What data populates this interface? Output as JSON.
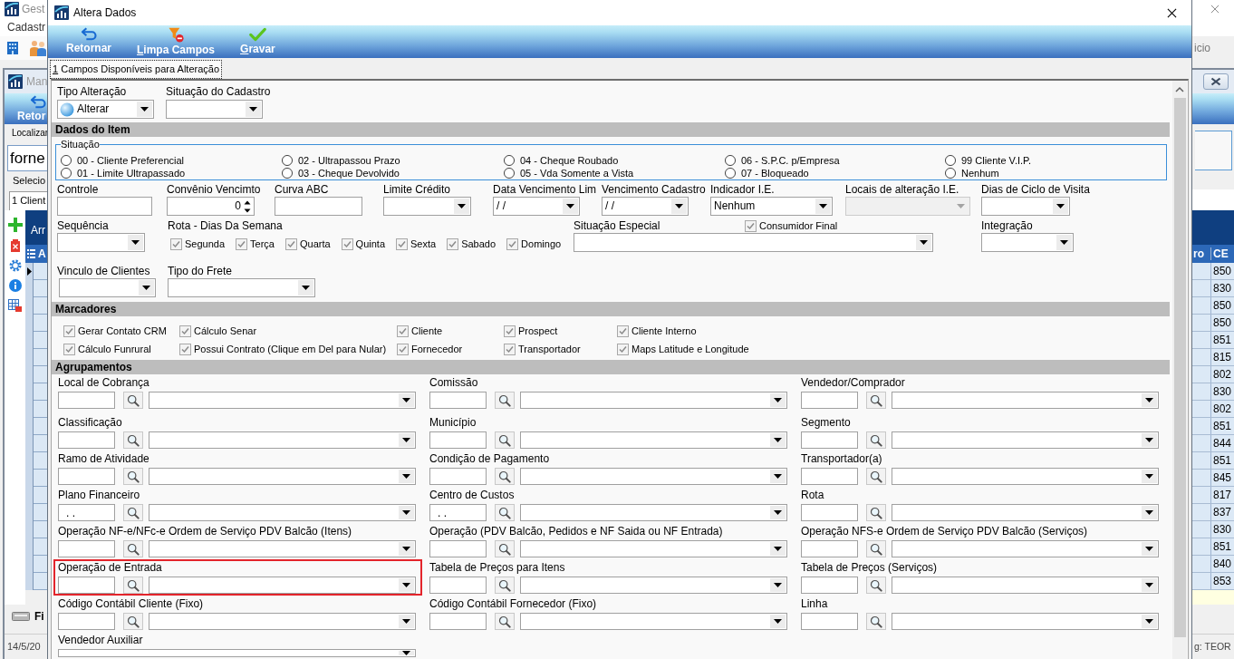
{
  "background_window": {
    "title": "Gest",
    "menu": [
      "Cadastr"
    ],
    "toolbar_text": "icio",
    "child_window": {
      "title": "Man",
      "toolbar_button": "Retor",
      "search": {
        "label": "Localizar",
        "value": "forne"
      },
      "selection_label": "Selecio",
      "tabs": [
        {
          "label": "1 Client",
          "selected": true
        }
      ],
      "grid": {
        "title": "Arr",
        "columns": [
          "A",
          "ro",
          "CE"
        ],
        "last_column_cells": [
          "850",
          "830",
          "850",
          "850",
          "851",
          "815",
          "802",
          "830",
          "802",
          "851",
          "844",
          "851",
          "845",
          "817",
          "837",
          "830",
          "851",
          "840",
          "853"
        ]
      },
      "bottom_tab": "Fi"
    },
    "status_bar": {
      "left": "14/5/20",
      "right": "g: TEOR"
    }
  },
  "dialog": {
    "title": "Altera Dados",
    "toolbar": [
      {
        "label": "Retornar",
        "access_key_underlined": false
      },
      {
        "label": "Limpa Campos",
        "access_key_underlined": true
      },
      {
        "label": "Gravar",
        "access_key_underlined": true
      }
    ],
    "tabs": [
      {
        "label": "1 Campos Disponíveis para Alteração",
        "selected": true,
        "access_key_underlined": true
      }
    ],
    "header_fields": [
      {
        "label": "Tipo Alteração",
        "kind": "image_combo",
        "value": "Alterar",
        "disabled": false
      },
      {
        "label": "Situação do Cadastro",
        "kind": "combo",
        "disabled": false
      }
    ],
    "sections": [
      {
        "kind": "item_data",
        "title": "Dados do Item",
        "status_group": {
          "label": "Situação",
          "options": [
            {
              "label": "00 - Cliente Preferencial",
              "selected": false
            },
            {
              "label": "01 - Limite Ultrapassado",
              "selected": false
            },
            {
              "label": "02 - Ultrapassou Prazo",
              "selected": false
            },
            {
              "label": "03 - Cheque Devolvido",
              "selected": false
            },
            {
              "label": "04 - Cheque Roubado",
              "selected": false
            },
            {
              "label": "05 - Vda Somente a Vista",
              "selected": false
            },
            {
              "label": "06 - S.P.C. p/Empresa",
              "selected": false
            },
            {
              "label": "07 - Bloqueado",
              "selected": false
            },
            {
              "label": "99 Cliente V.I.P.",
              "selected": false
            },
            {
              "label": "Nenhum",
              "selected": false
            }
          ]
        },
        "field_rows": [
          [
            {
              "label": "Controle",
              "kind": "text",
              "disabled": false
            },
            {
              "label": "Convênio Vencimto",
              "kind": "spin",
              "value": "0",
              "disabled": false
            },
            {
              "label": "Curva ABC",
              "kind": "text",
              "disabled": false
            },
            {
              "label": "Limite Crédito",
              "kind": "combo",
              "disabled": false
            },
            {
              "label": "Data Vencimento Lim",
              "kind": "combo",
              "value": "/ /",
              "disabled": false
            },
            {
              "label": "Vencimento Cadastro",
              "kind": "combo",
              "value": "/ /",
              "disabled": false
            },
            {
              "label": "Indicador I.E.",
              "kind": "combo",
              "value": "Nenhum",
              "disabled": false
            },
            {
              "label": "Locais de alteração I.E.",
              "kind": "combo",
              "disabled": true
            },
            {
              "label": "Dias de Ciclo de Visita",
              "kind": "combo",
              "disabled": false
            }
          ],
          [
            {
              "label": "Sequência",
              "kind": "combo",
              "disabled": false
            },
            {
              "label": "Rota - Dias Da Semana",
              "kind": "check_group",
              "options": [
                {
                  "label": "Segunda",
                  "checked": true
                },
                {
                  "label": "Terça",
                  "checked": true
                },
                {
                  "label": "Quarta",
                  "checked": true
                },
                {
                  "label": "Quinta",
                  "checked": true
                },
                {
                  "label": "Sexta",
                  "checked": true
                },
                {
                  "label": "Sabado",
                  "checked": true
                },
                {
                  "label": "Domingo",
                  "checked": true
                }
              ]
            },
            {
              "label": "Situação Especial",
              "kind": "combo",
              "disabled": false,
              "checkbox": {
                "label": "Consumidor Final",
                "checked": true
              }
            },
            {
              "label": "Integração",
              "kind": "combo",
              "disabled": false
            }
          ],
          [
            {
              "label": "Vinculo de Clientes",
              "kind": "combo",
              "disabled": false
            },
            {
              "label": "Tipo do Frete",
              "kind": "combo",
              "disabled": false
            }
          ]
        ]
      },
      {
        "kind": "markers",
        "title": "Marcadores",
        "checkboxes": [
          {
            "label": "Gerar Contato CRM",
            "checked": true
          },
          {
            "label": "Cálculo Senar",
            "checked": true
          },
          {
            "label": "Cliente",
            "checked": true
          },
          {
            "label": "Prospect",
            "checked": true
          },
          {
            "label": "Cliente Interno",
            "checked": true
          },
          {
            "label": "Cálculo Funrural",
            "checked": true
          },
          {
            "label": "Possui Contrato (Clique em Del para Nular)",
            "checked": true
          },
          {
            "label": "Fornecedor",
            "checked": true
          },
          {
            "label": "Transportador",
            "checked": true
          },
          {
            "label": "Maps Latitude e Longitude",
            "checked": true
          }
        ]
      },
      {
        "kind": "groupings",
        "title": "Agrupamentos",
        "fields": [
          {
            "label": "Local de Cobrança",
            "kind": "lookup",
            "highlighted": false
          },
          {
            "label": "Comissão",
            "kind": "lookup",
            "highlighted": false
          },
          {
            "label": "Vendedor/Comprador",
            "kind": "lookup",
            "highlighted": false
          },
          {
            "label": "Classificação",
            "kind": "lookup",
            "highlighted": false
          },
          {
            "label": "Município",
            "kind": "lookup",
            "highlighted": false
          },
          {
            "label": "Segmento",
            "kind": "lookup",
            "highlighted": false
          },
          {
            "label": "Ramo de Atividade",
            "kind": "lookup",
            "highlighted": false
          },
          {
            "label": "Condição de Pagamento",
            "kind": "lookup",
            "highlighted": false
          },
          {
            "label": "Transportador(a)",
            "kind": "lookup",
            "highlighted": false
          },
          {
            "label": "Plano Financeiro",
            "kind": "lookup",
            "code": ". .",
            "highlighted": false
          },
          {
            "label": "Centro de Custos",
            "kind": "lookup",
            "code": ". .",
            "highlighted": false
          },
          {
            "label": "Rota",
            "kind": "lookup",
            "highlighted": false
          },
          {
            "label": "Operação NF-e/NFc-e Ordem de Serviço PDV Balcão (Itens)",
            "kind": "lookup",
            "highlighted": false
          },
          {
            "label": "Operação (PDV Balcão, Pedidos e NF Saida ou NF Entrada)",
            "kind": "lookup",
            "highlighted": false
          },
          {
            "label": "Operação NFS-e Ordem de Serviço PDV Balcão (Serviços)",
            "kind": "lookup",
            "highlighted": false
          },
          {
            "label": "Operação de Entrada",
            "kind": "lookup",
            "highlighted": true
          },
          {
            "label": "Tabela de Preços para Itens",
            "kind": "lookup",
            "highlighted": false
          },
          {
            "label": "Tabela de Preços (Serviços)",
            "kind": "lookup",
            "highlighted": false
          },
          {
            "label": "Código Contábil Cliente (Fixo)",
            "kind": "lookup",
            "highlighted": false
          },
          {
            "label": "Código Contábil Fornecedor (Fixo)",
            "kind": "lookup",
            "highlighted": false
          },
          {
            "label": "Linha",
            "kind": "lookup",
            "highlighted": false
          },
          {
            "label": "Vendedor Auxiliar",
            "kind": "combo",
            "highlighted": false
          }
        ]
      }
    ]
  }
}
